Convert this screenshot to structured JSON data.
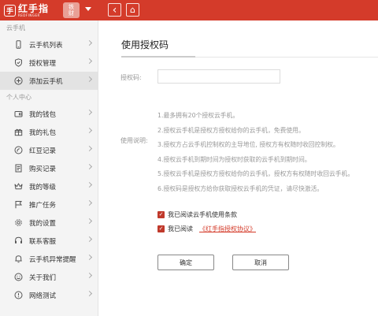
{
  "topbar": {
    "logo": {
      "cn": "红手指",
      "en": "REDFINGER",
      "mark": "手"
    },
    "user": {
      "line1": "铁",
      "line2": "财"
    },
    "back_glyph": "‹",
    "home_glyph": "⌂"
  },
  "sidebar": {
    "sections": [
      {
        "title": "云手机",
        "items": [
          {
            "label": "云手机列表",
            "icon": "phone-icon"
          },
          {
            "label": "授权管理",
            "icon": "shield-icon"
          },
          {
            "label": "添加云手机",
            "icon": "add-circle-icon",
            "active": true
          }
        ]
      },
      {
        "title": "个人中心",
        "items": [
          {
            "label": "我的钱包",
            "icon": "wallet-icon"
          },
          {
            "label": "我的礼包",
            "icon": "gift-icon"
          },
          {
            "label": "红豆记录",
            "icon": "bean-icon"
          },
          {
            "label": "购买记录",
            "icon": "receipt-icon"
          },
          {
            "label": "我的等级",
            "icon": "crown-icon"
          },
          {
            "label": "推广任务",
            "icon": "flag-icon"
          },
          {
            "label": "我的设置",
            "icon": "gear-icon"
          },
          {
            "label": "联系客服",
            "icon": "headset-icon"
          },
          {
            "label": "云手机异常提醒",
            "icon": "bell-icon"
          },
          {
            "label": "关于我们",
            "icon": "smile-icon"
          },
          {
            "label": "网络测试",
            "icon": "network-icon"
          }
        ]
      }
    ]
  },
  "main": {
    "title": "使用授权码",
    "code_label": "授权码:",
    "code_value": "",
    "desc_label": "使用说明:",
    "desc_lines": [
      "1.最多拥有20个授权云手机。",
      "2.授权云手机是授权方授权给你的云手机，免费使用。",
      "3.授权方占云手机控制权的主导地位, 授权方有权随时收回控制权。",
      "4.授权云手机到期时间为授权时获取的云手机到期时间。",
      "5.授权云手机是授权方授权给你的云手机，授权方有权随时收回云手机。",
      "6.授权码是授权方给你获取授权云手机的凭证，请尽快激活。"
    ],
    "check1": "我已阅读云手机使用条款",
    "check2": "我已阅读",
    "check2_link": "《红手指授权协议》",
    "confirm": "确定",
    "cancel": "取消"
  },
  "colors": {
    "brand": "#d43b2a",
    "checkbox": "#c0392b"
  }
}
